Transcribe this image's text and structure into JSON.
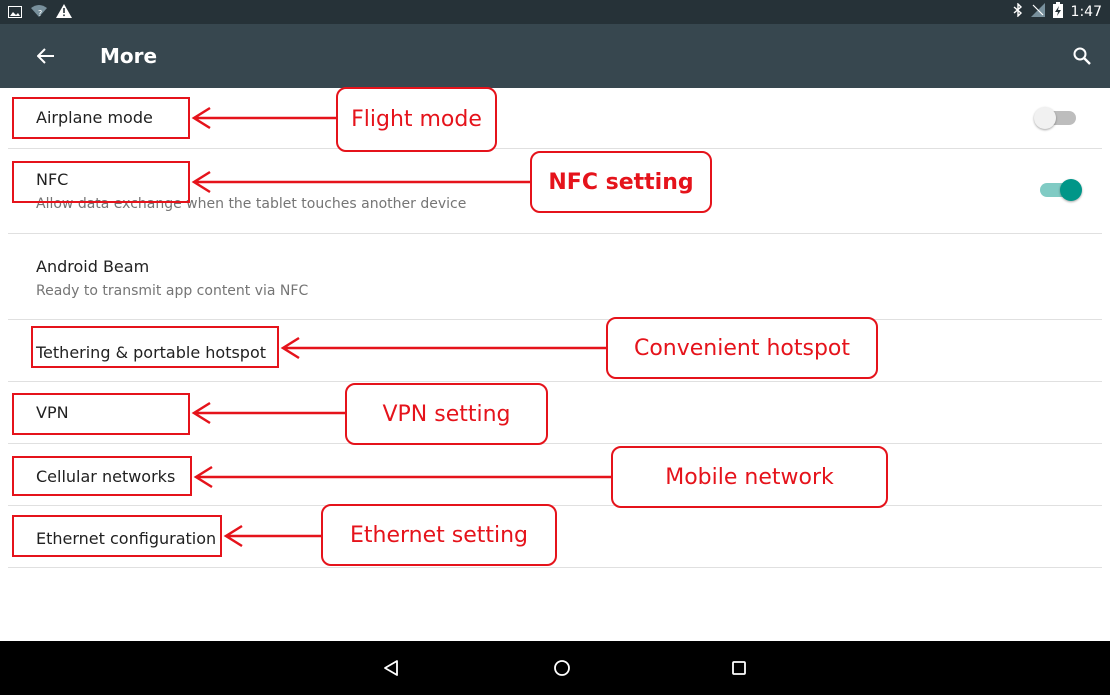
{
  "status_bar": {
    "time": "1:47",
    "left_icons": [
      "image-icon",
      "wifi-unknown-icon",
      "warning-icon"
    ],
    "right_icons": [
      "bluetooth-icon",
      "signal-off-icon",
      "battery-charging-icon"
    ]
  },
  "toolbar": {
    "title": "More",
    "back_icon": "arrow-left-icon",
    "search_icon": "search-icon"
  },
  "settings": [
    {
      "label": "Airplane mode",
      "toggle": "off"
    },
    {
      "label": "NFC",
      "sub": "Allow data exchange when the tablet touches another device",
      "toggle": "on"
    },
    {
      "label": "Android Beam",
      "sub": "Ready to transmit app content via NFC"
    },
    {
      "label": "Tethering & portable hotspot"
    },
    {
      "label": "VPN"
    },
    {
      "label": "Cellular networks"
    },
    {
      "label": "Ethernet configuration"
    }
  ],
  "annotations": [
    {
      "text": "Flight mode"
    },
    {
      "text": "NFC setting"
    },
    {
      "text": "Convenient hotspot"
    },
    {
      "text": "VPN setting"
    },
    {
      "text": "Mobile network"
    },
    {
      "text": "Ethernet setting"
    }
  ],
  "colors": {
    "status_bar": "#263238",
    "toolbar": "#37474f",
    "accent": "#009688",
    "annotation_red": "#e5131b"
  },
  "nav_bar": {
    "icons": [
      "back-triangle-icon",
      "home-circle-icon",
      "recents-square-icon"
    ]
  }
}
